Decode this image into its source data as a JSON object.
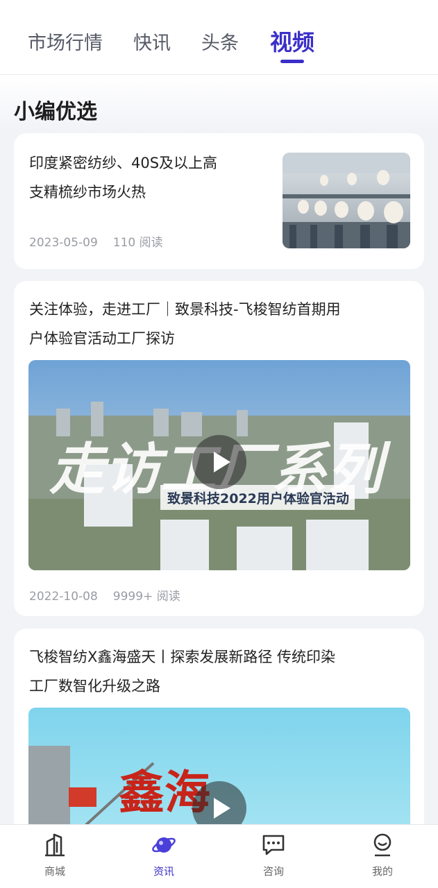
{
  "tabs": [
    {
      "label": "市场行情",
      "active": false
    },
    {
      "label": "快讯",
      "active": false
    },
    {
      "label": "头条",
      "active": false
    },
    {
      "label": "视频",
      "active": true
    }
  ],
  "section_title": "小编优选",
  "articles": [
    {
      "title_line1": "印度紧密纺纱、40S及以上高",
      "title_line2": "支精梳纱市场火热",
      "date": "2023-05-09",
      "reads": "110 阅读",
      "image": "spinning-machines-photo"
    },
    {
      "title_line1": "关注体验，走进工厂｜致景科技-飞梭智纺首期用",
      "title_line2": "户体验官活动工厂探访",
      "video_overlay_title": "走访工厂系列",
      "video_overlay_subtitle": "致景科技2022用户体验官活动",
      "date": "2022-10-08",
      "reads": "9999+ 阅读",
      "image": "aerial-factory-video"
    },
    {
      "title_line1": "飞梭智纺X鑫海盛天丨探索发展新路径 传统印染",
      "title_line2": "工厂数智化升级之路",
      "sign_text": "鑫海",
      "image": "factory-sign-video"
    }
  ],
  "bottom_nav": [
    {
      "label": "商城",
      "icon": "building-icon",
      "active": false
    },
    {
      "label": "资讯",
      "icon": "planet-icon",
      "active": true
    },
    {
      "label": "咨询",
      "icon": "chat-icon",
      "active": false
    },
    {
      "label": "我的",
      "icon": "profile-icon",
      "active": false
    }
  ],
  "colors": {
    "accent": "#3b2fc9",
    "background": "#f2f3f7"
  }
}
